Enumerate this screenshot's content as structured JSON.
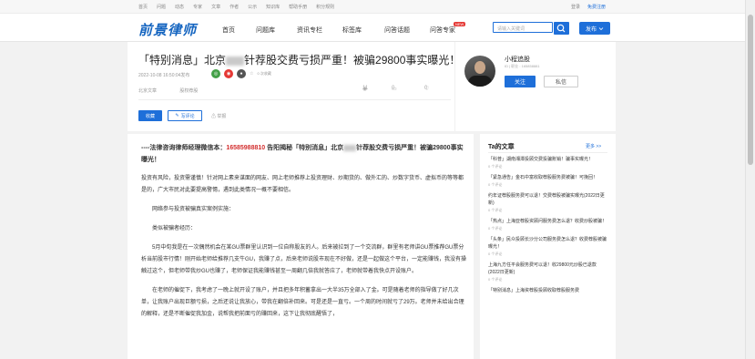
{
  "topbar": {
    "links": [
      "首页",
      "问题",
      "动态",
      "专家",
      "文章",
      "作者",
      "公示",
      "知识库",
      "帮助手册",
      "积分规则"
    ],
    "login": "登录",
    "register": "免费注册"
  },
  "nav": {
    "logo": "前景律师",
    "menu": [
      "首页",
      "问题库",
      "资讯专栏",
      "标签库",
      "问答话题",
      "问答专家"
    ],
    "new_badge": "NEW",
    "search_placeholder": "请输入关键词",
    "publish_label": "发布"
  },
  "article": {
    "title_prefix": "「特别消息」北京",
    "title_suffix": "针荐股交费亏损严重！被骗29800事实曝光！",
    "date": "2022-10-08 16:50:04发布",
    "collected": "0 次收藏",
    "tags": [
      "北京文章",
      "股权荐股"
    ],
    "views": "11",
    "comments": "0",
    "likes": "0",
    "collect_label": "收藏",
    "comment_label": "写评论",
    "report_label": "举报"
  },
  "author": {
    "name": "小程追股",
    "id": "ID | 职业 : 165858881",
    "follow_label": "关注",
    "message_label": "私信"
  },
  "body": {
    "lead_prefix": "----法律咨询律师经理微信本：",
    "phone": "16585988810",
    "lead_mid": " 告阳揭秘「特别消息」北京",
    "lead_suffix": "针荐股交费亏损严重！被骗29800事实曝光！",
    "p1": "投资有风险，投资需谨慎！针对网上素来谋面的网友、网上老师推荐上投资理财、炒期货的、做外汇的、炒数字货币、虚拟币的等等都是的，广大市民对此要提高警惕，遇到此类情况一概不要相信。",
    "p2": "网络参与投资被骗真实案例实施：",
    "p3": "类似被骗者经历：",
    "p4": "5月中旬我是在一次偶然机会在某GU票群里认识到一位自称股友的人。后来被拉到了一个交流群，群里有老师讲GU票推荐GU票分析当前股市行情！刚开始老师给推荐几支牛GU，我赚了点，后来老师说股市现在不好做，还是一起做这个平台，一定能赚钱，我没有操触过这个，但老师带我炒GU也赚了，老师保证我能赚钱甚至一周翻几倍我就答应了，老师就带着我快点开设账户。",
    "p5": "在老师的催促下，我考虑了一晚上就开设了账户，并且把多年积蓄拿出一大半35万全部入了金。可是随着老师的指导做了好几次单，让我账户出现巨额亏损，之后还说让我放心，带我在翻倍补回来。可是还是一直亏。一个周的时间就亏了29万。老师并未给出合理的解释，还是不断催促我加金，说帮我把前面亏的赚回来，这下让我彻底醒悟了，"
  },
  "sidebar": {
    "title": "Ta的文章",
    "more": "更多 >>",
    "items": [
      {
        "title": "「科普」湖南湘潭投顾交费投骗账销！骗事实曝光！",
        "sub": "0 个评论"
      },
      {
        "title": "「紧急通告」金石中富收取荐股服务费被骗！可挽回！",
        "sub": "0 个评论"
      },
      {
        "title": "约年证荐股服务费可以退！交费荐股被骗实曝光(2022日更新)",
        "sub": "0 个评论"
      },
      {
        "title": "「热点」上海亚荐股资顾问服务费怎么退？收费炒股被骗！",
        "sub": "0 个评论"
      },
      {
        "title": "「头条」民众投顾长沙分公司服务费怎么退？收费荐股被骗曝光！",
        "sub": "0 个评论"
      },
      {
        "title": "上海九方任平会服务费可以退！收29800元炒股已退款(2022日更新)",
        "sub": "0 个评论"
      },
      {
        "title": "「特别消息」上海资荐股投顾收取荐股服务费",
        "sub": ""
      }
    ]
  },
  "colors": {
    "accent": "#1e6fd9",
    "phone": "#d32f2f",
    "badge": "#e53935"
  }
}
